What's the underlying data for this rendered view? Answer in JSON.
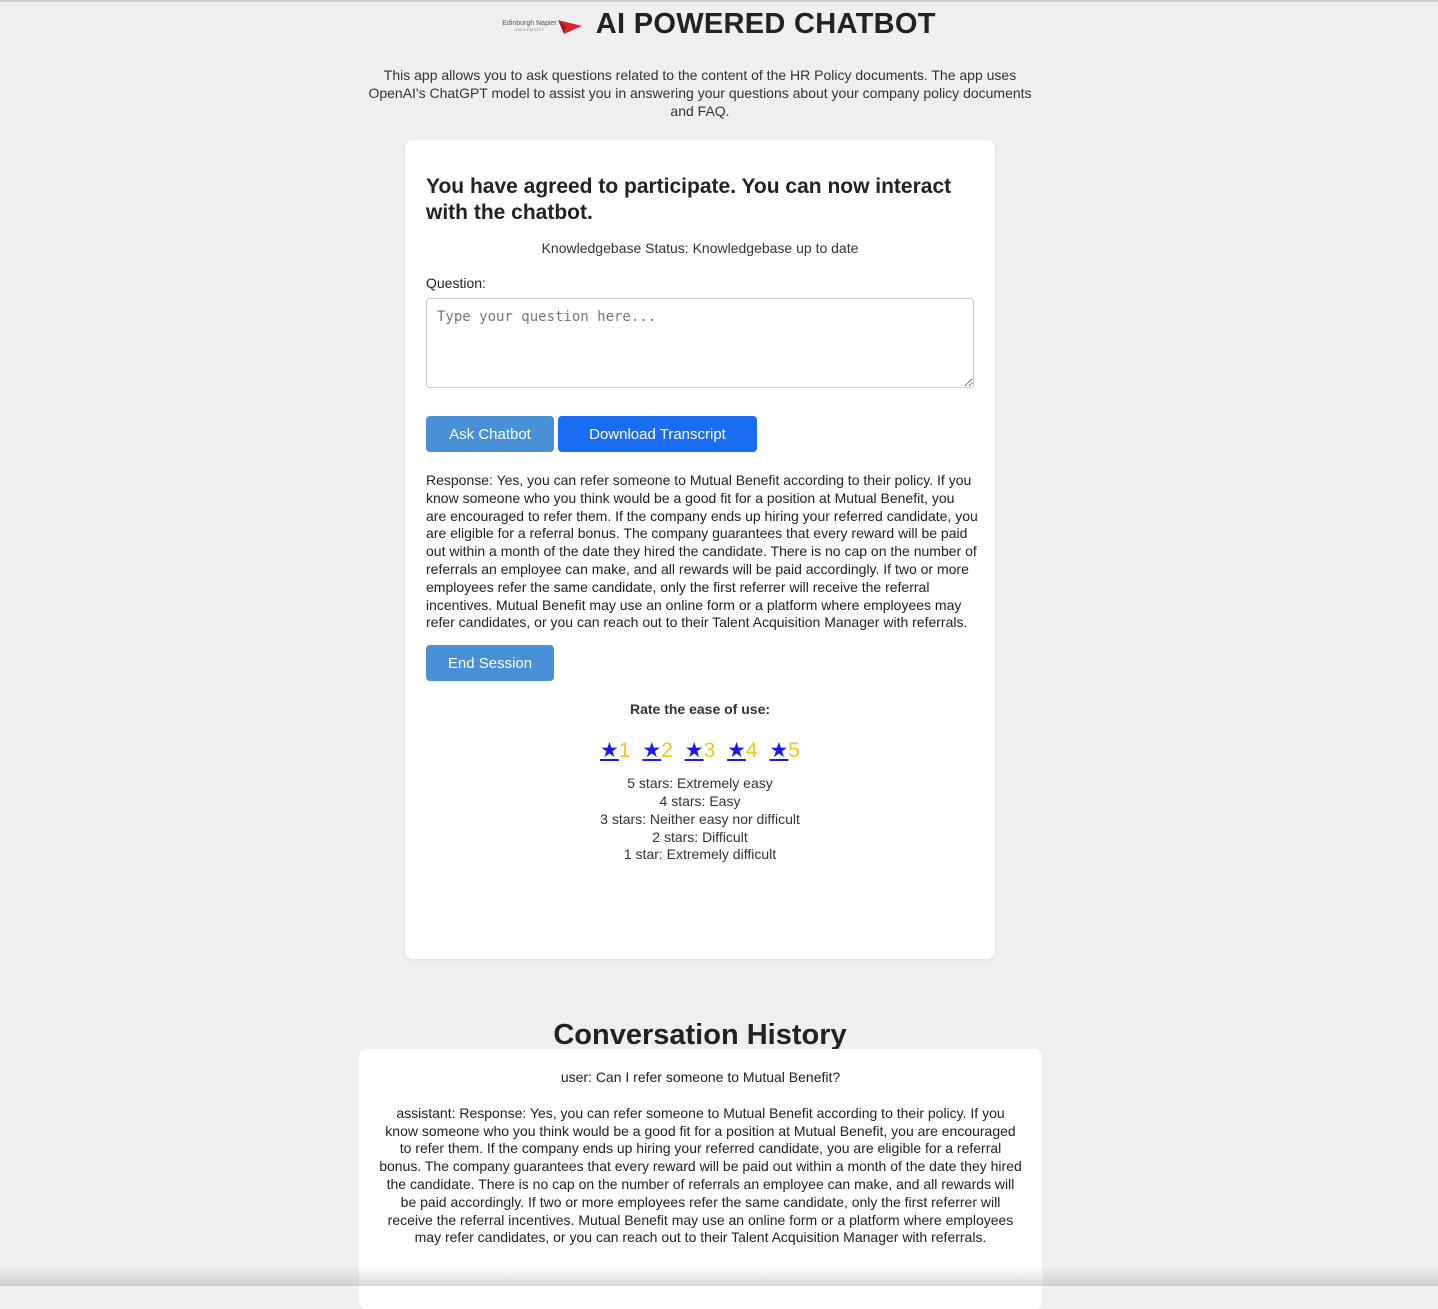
{
  "header": {
    "logo_name": "Edinburgh Napier",
    "logo_sub": "UNIVERSITY",
    "title": "AI POWERED CHATBOT"
  },
  "intro": "This app allows you to ask questions related to the content of the HR Policy documents. The app uses OpenAI's ChatGPT model to assist you in answering your questions about your company policy documents and FAQ.",
  "card": {
    "heading": "You have agreed to participate. You can now interact with the chatbot.",
    "kb_status": "Knowledgebase Status: Knowledgebase up to date",
    "question_label": "Question:",
    "question_value": "",
    "question_placeholder": "Type your question here...",
    "ask_button": "Ask Chatbot",
    "download_button": "Download Transcript",
    "response": "Response: Yes, you can refer someone to Mutual Benefit according to their policy. If you know someone who you think would be a good fit for a position at Mutual Benefit, you are encouraged to refer them. If the company ends up hiring your referred candidate, you are eligible for a referral bonus. The company guarantees that every reward will be paid out within a month of the date they hired the candidate. There is no cap on the number of referrals an employee can make, and all rewards will be paid accordingly. If two or more employees refer the same candidate, only the first referrer will receive the referral incentives. Mutual Benefit may use an online form or a platform where employees may refer candidates, or you can reach out to their Talent Acquisition Manager with referrals.",
    "end_button": "End Session",
    "rate_label": "Rate the ease of use:",
    "stars": [
      {
        "glyph": "★",
        "num": "1"
      },
      {
        "glyph": "★",
        "num": "2"
      },
      {
        "glyph": "★",
        "num": "3"
      },
      {
        "glyph": "★",
        "num": "4"
      },
      {
        "glyph": "★",
        "num": "5"
      }
    ],
    "legend": [
      "5 stars: Extremely easy",
      "4 stars: Easy",
      "3 stars: Neither easy nor difficult",
      "2 stars: Difficult",
      "1 star: Extremely difficult"
    ]
  },
  "history": {
    "title": "Conversation History",
    "messages": [
      "user: Can I refer someone to Mutual Benefit?",
      "assistant: Response: Yes, you can refer someone to Mutual Benefit according to their policy. If you know someone who you think would be a good fit for a position at Mutual Benefit, you are encouraged to refer them. If the company ends up hiring your referred candidate, you are eligible for a referral bonus. The company guarantees that every reward will be paid out within a month of the date they hired the candidate. There is no cap on the number of referrals an employee can make, and all rewards will be paid accordingly. If two or more employees refer the same candidate, only the first referrer will receive the referral incentives. Mutual Benefit may use an online form or a platform where employees may refer candidates, or you can reach out to their Talent Acquisition Manager with referrals."
    ]
  },
  "colors": {
    "page_bg": "#efefef",
    "card_bg": "#ffffff",
    "primary_button": "#4a90d6",
    "download_button": "#1a6cf0",
    "star_link": "#1a1aee",
    "star_number": "#f5c518",
    "logo_red": "#d9232e"
  }
}
